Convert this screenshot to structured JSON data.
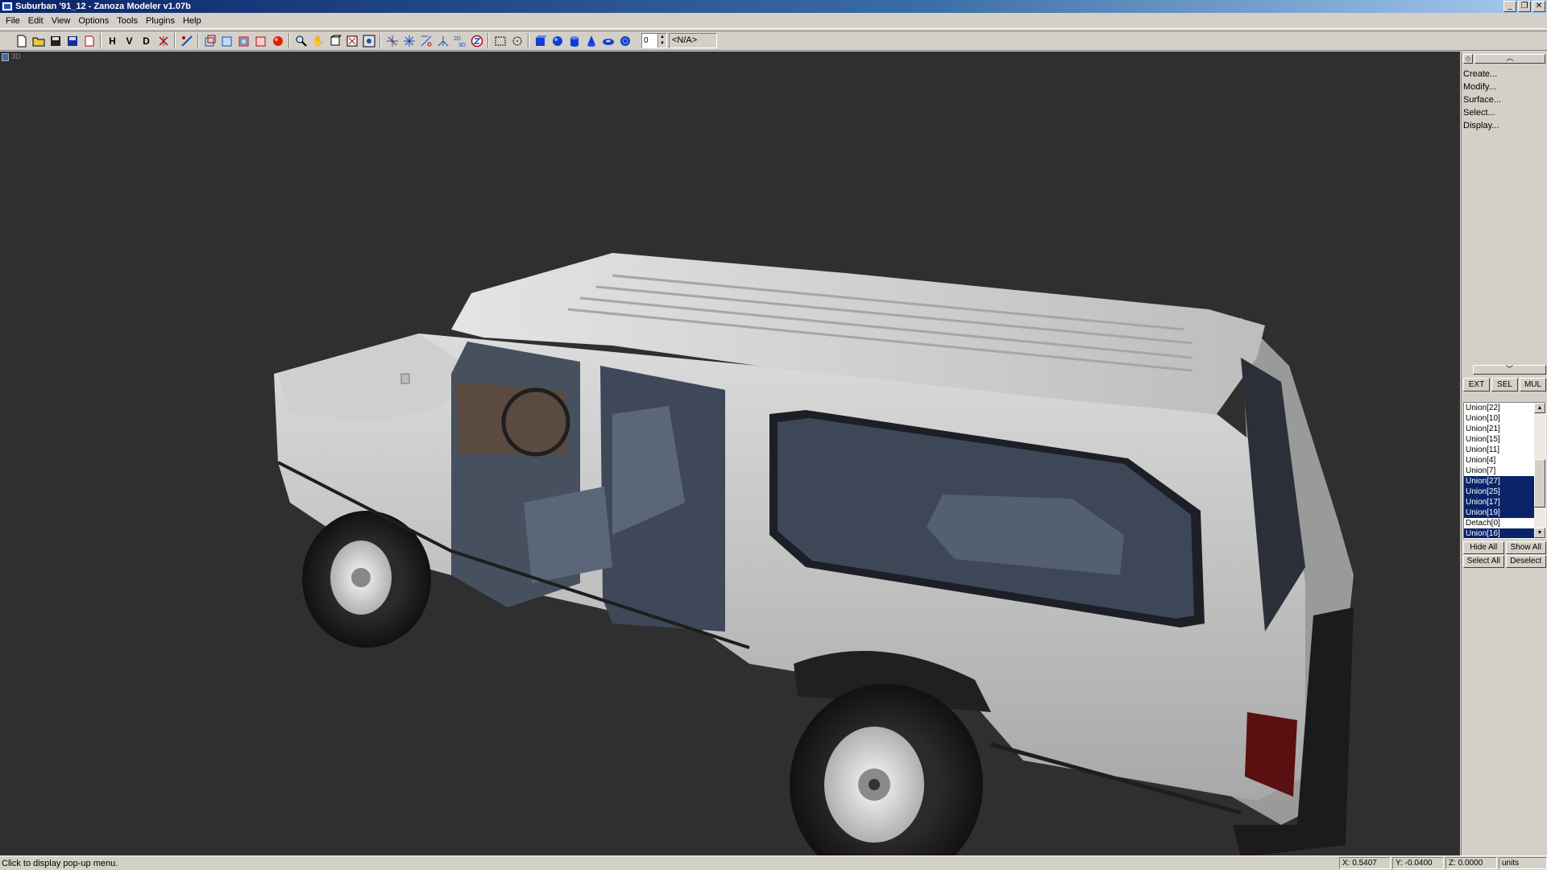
{
  "window": {
    "title": "Suburban '91_12 - Zanoza Modeler v1.07b",
    "controls": [
      "minimize",
      "restore",
      "close"
    ]
  },
  "menu": [
    "File",
    "Edit",
    "View",
    "Options",
    "Tools",
    "Plugins",
    "Help"
  ],
  "toolbar": {
    "text_buttons": [
      "H",
      "V",
      "D"
    ],
    "spin_value": "0",
    "combo_value": "<N/A>"
  },
  "viewport": {
    "label": "3D",
    "background": "#2f2f2f"
  },
  "side_panel": {
    "commands": [
      "Create...",
      "Modify...",
      "Surface...",
      "Select...",
      "Display..."
    ],
    "modes": [
      "EXT",
      "SEL",
      "MUL"
    ],
    "objects": [
      {
        "label": "Union[22]",
        "selected": false
      },
      {
        "label": "Union[10]",
        "selected": false
      },
      {
        "label": "Union[21]",
        "selected": false
      },
      {
        "label": "Union[15]",
        "selected": false
      },
      {
        "label": "Union[11]",
        "selected": false
      },
      {
        "label": "Union[4]",
        "selected": false
      },
      {
        "label": "Union[7]",
        "selected": false
      },
      {
        "label": "Union[27]",
        "selected": true
      },
      {
        "label": "Union[25]",
        "selected": true
      },
      {
        "label": "Union[17]",
        "selected": true
      },
      {
        "label": "Union[19]",
        "selected": true
      },
      {
        "label": "Detach[0]",
        "selected": false
      },
      {
        "label": "Union[16]",
        "selected": true
      }
    ],
    "hide_all": "Hide All",
    "show_all": "Show All",
    "select_all": "Select All",
    "deselect": "Deselect"
  },
  "status": {
    "message": "Click to display pop-up menu.",
    "x": "X: 0.5407",
    "y": "Y: -0.0400",
    "z": "Z: 0.0000",
    "units": "units"
  },
  "colors": {
    "selection": "#0a246a",
    "titlebar": "#0a246a",
    "car_body": "#c9c9c9",
    "interior": "#4a5566"
  }
}
